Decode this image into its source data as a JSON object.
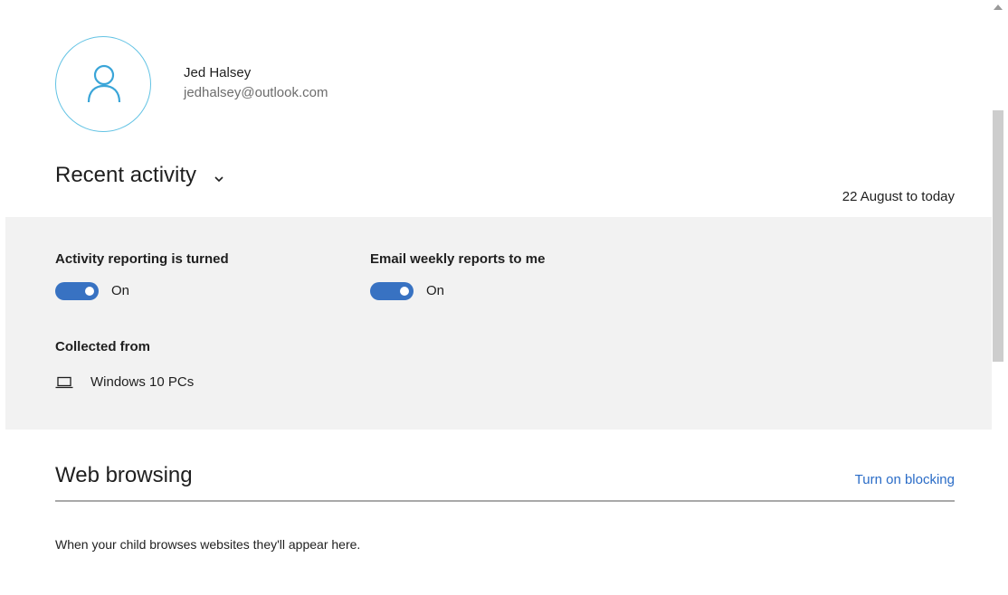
{
  "profile": {
    "name": "Jed Halsey",
    "email": "jedhalsey@outlook.com"
  },
  "recent_activity": {
    "title": "Recent activity",
    "date_range": "22 August to today"
  },
  "settings": {
    "activity_reporting": {
      "label": "Activity reporting is turned",
      "state": "On"
    },
    "email_reports": {
      "label": "Email weekly reports to me",
      "state": "On"
    },
    "collected_from": {
      "label": "Collected from",
      "device": "Windows 10 PCs"
    }
  },
  "web_browsing": {
    "title": "Web browsing",
    "link": "Turn on blocking",
    "empty_message": "When your child browses websites they'll appear here."
  },
  "colors": {
    "accent": "#3872c2",
    "link": "#2a6cc7",
    "avatar_ring": "#63c3e4",
    "panel_bg": "#f2f2f2"
  },
  "icons": [
    "person-icon",
    "chevron-down-icon",
    "laptop-icon",
    "scroll-up-arrow-icon"
  ]
}
